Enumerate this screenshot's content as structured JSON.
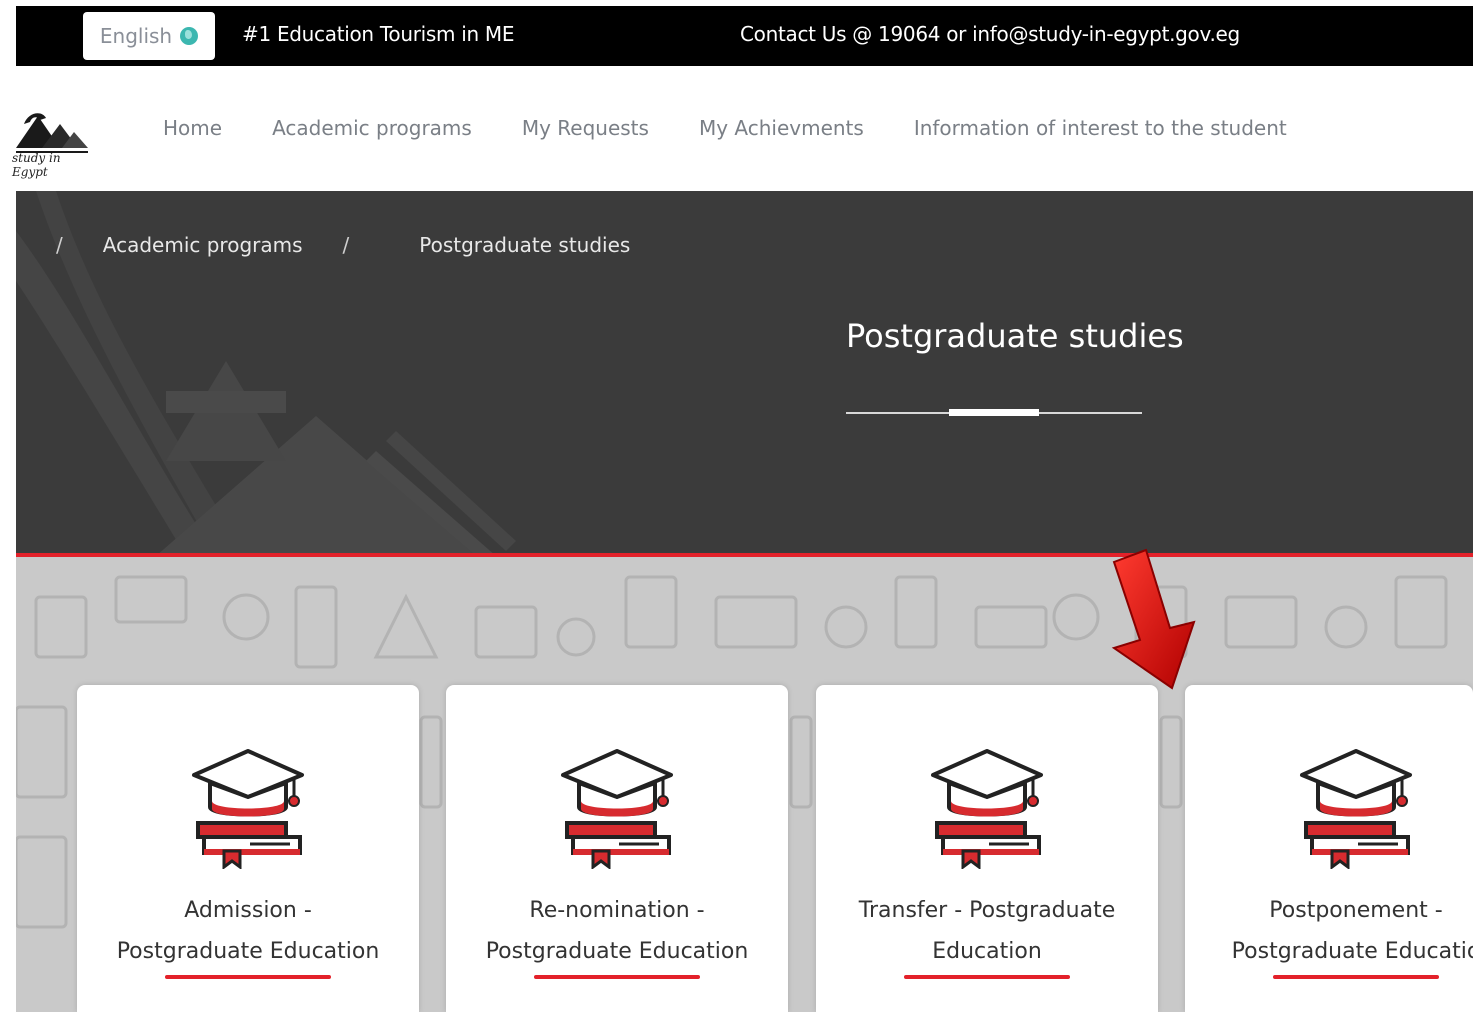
{
  "topbar": {
    "language": "English",
    "tagline": "#1 Education Tourism in ME",
    "contact": "Contact Us @ 19064 or info@study-in-egypt.gov.eg"
  },
  "logo": {
    "text": "study in Egypt"
  },
  "nav": {
    "items": [
      {
        "label": "Home"
      },
      {
        "label": "Academic programs"
      },
      {
        "label": "My Requests"
      },
      {
        "label": "My Achievments"
      },
      {
        "label": "Information of interest to the student"
      }
    ]
  },
  "hero": {
    "breadcrumb": [
      {
        "label": "Academic programs"
      },
      {
        "label": "Postgraduate studies"
      }
    ],
    "title": "Postgraduate studies"
  },
  "cards": [
    {
      "line1": "Admission -",
      "line2": "Postgraduate Education"
    },
    {
      "line1": "Re-nomination -",
      "line2": "Postgraduate Education"
    },
    {
      "line1": "Transfer - Postgraduate",
      "line2": "Education"
    },
    {
      "line1": "Postponement -",
      "line2": "Postgraduate Educatio"
    }
  ],
  "colors": {
    "accent_red": "#e3212a",
    "hero_bg": "#3b3b3b",
    "topbar_bg": "#000000"
  },
  "icons": {
    "globe": "globe-icon",
    "card_icon": "graduation-cap-books-icon",
    "annotation": "red-arrow-annotation"
  }
}
